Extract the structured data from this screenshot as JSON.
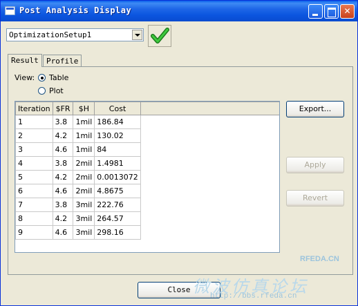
{
  "window": {
    "title": "Post Analysis Display"
  },
  "setup": {
    "selected": "OptimizationSetup1"
  },
  "tabs": [
    {
      "label": "Result"
    },
    {
      "label": "Profile"
    }
  ],
  "view": {
    "label": "View:",
    "options": [
      {
        "label": "Table",
        "selected": true
      },
      {
        "label": "Plot",
        "selected": false
      }
    ]
  },
  "table": {
    "columns": [
      "Iteration",
      "$FR",
      "$H",
      "Cost"
    ],
    "rows": [
      [
        "1",
        "3.8",
        "1mil",
        "186.84"
      ],
      [
        "2",
        "4.2",
        "1mil",
        "130.02"
      ],
      [
        "3",
        "4.6",
        "1mil",
        "84"
      ],
      [
        "4",
        "3.8",
        "2mil",
        "1.4981"
      ],
      [
        "5",
        "4.2",
        "2mil",
        "0.0013072"
      ],
      [
        "6",
        "4.6",
        "2mil",
        "4.8675"
      ],
      [
        "7",
        "3.8",
        "3mil",
        "222.76"
      ],
      [
        "8",
        "4.2",
        "3mil",
        "264.57"
      ],
      [
        "9",
        "4.6",
        "3mil",
        "298.16"
      ]
    ]
  },
  "buttons": {
    "export": "Export...",
    "apply": "Apply",
    "revert": "Revert",
    "close": "Close"
  },
  "watermark": {
    "brand": "RFEDA.CN",
    "chinese": "微波仿真论坛",
    "url": "http://bbs.rfeda.cn"
  },
  "colors": {
    "title_bar": "#0A5EEB",
    "check_mark": "#2FA52F",
    "close_button": "#C8411E"
  },
  "icons": {
    "check": "check-icon",
    "dropdown": "chevron-down-icon",
    "minimize": "minimize-icon",
    "maximize": "maximize-icon",
    "close": "close-icon"
  }
}
